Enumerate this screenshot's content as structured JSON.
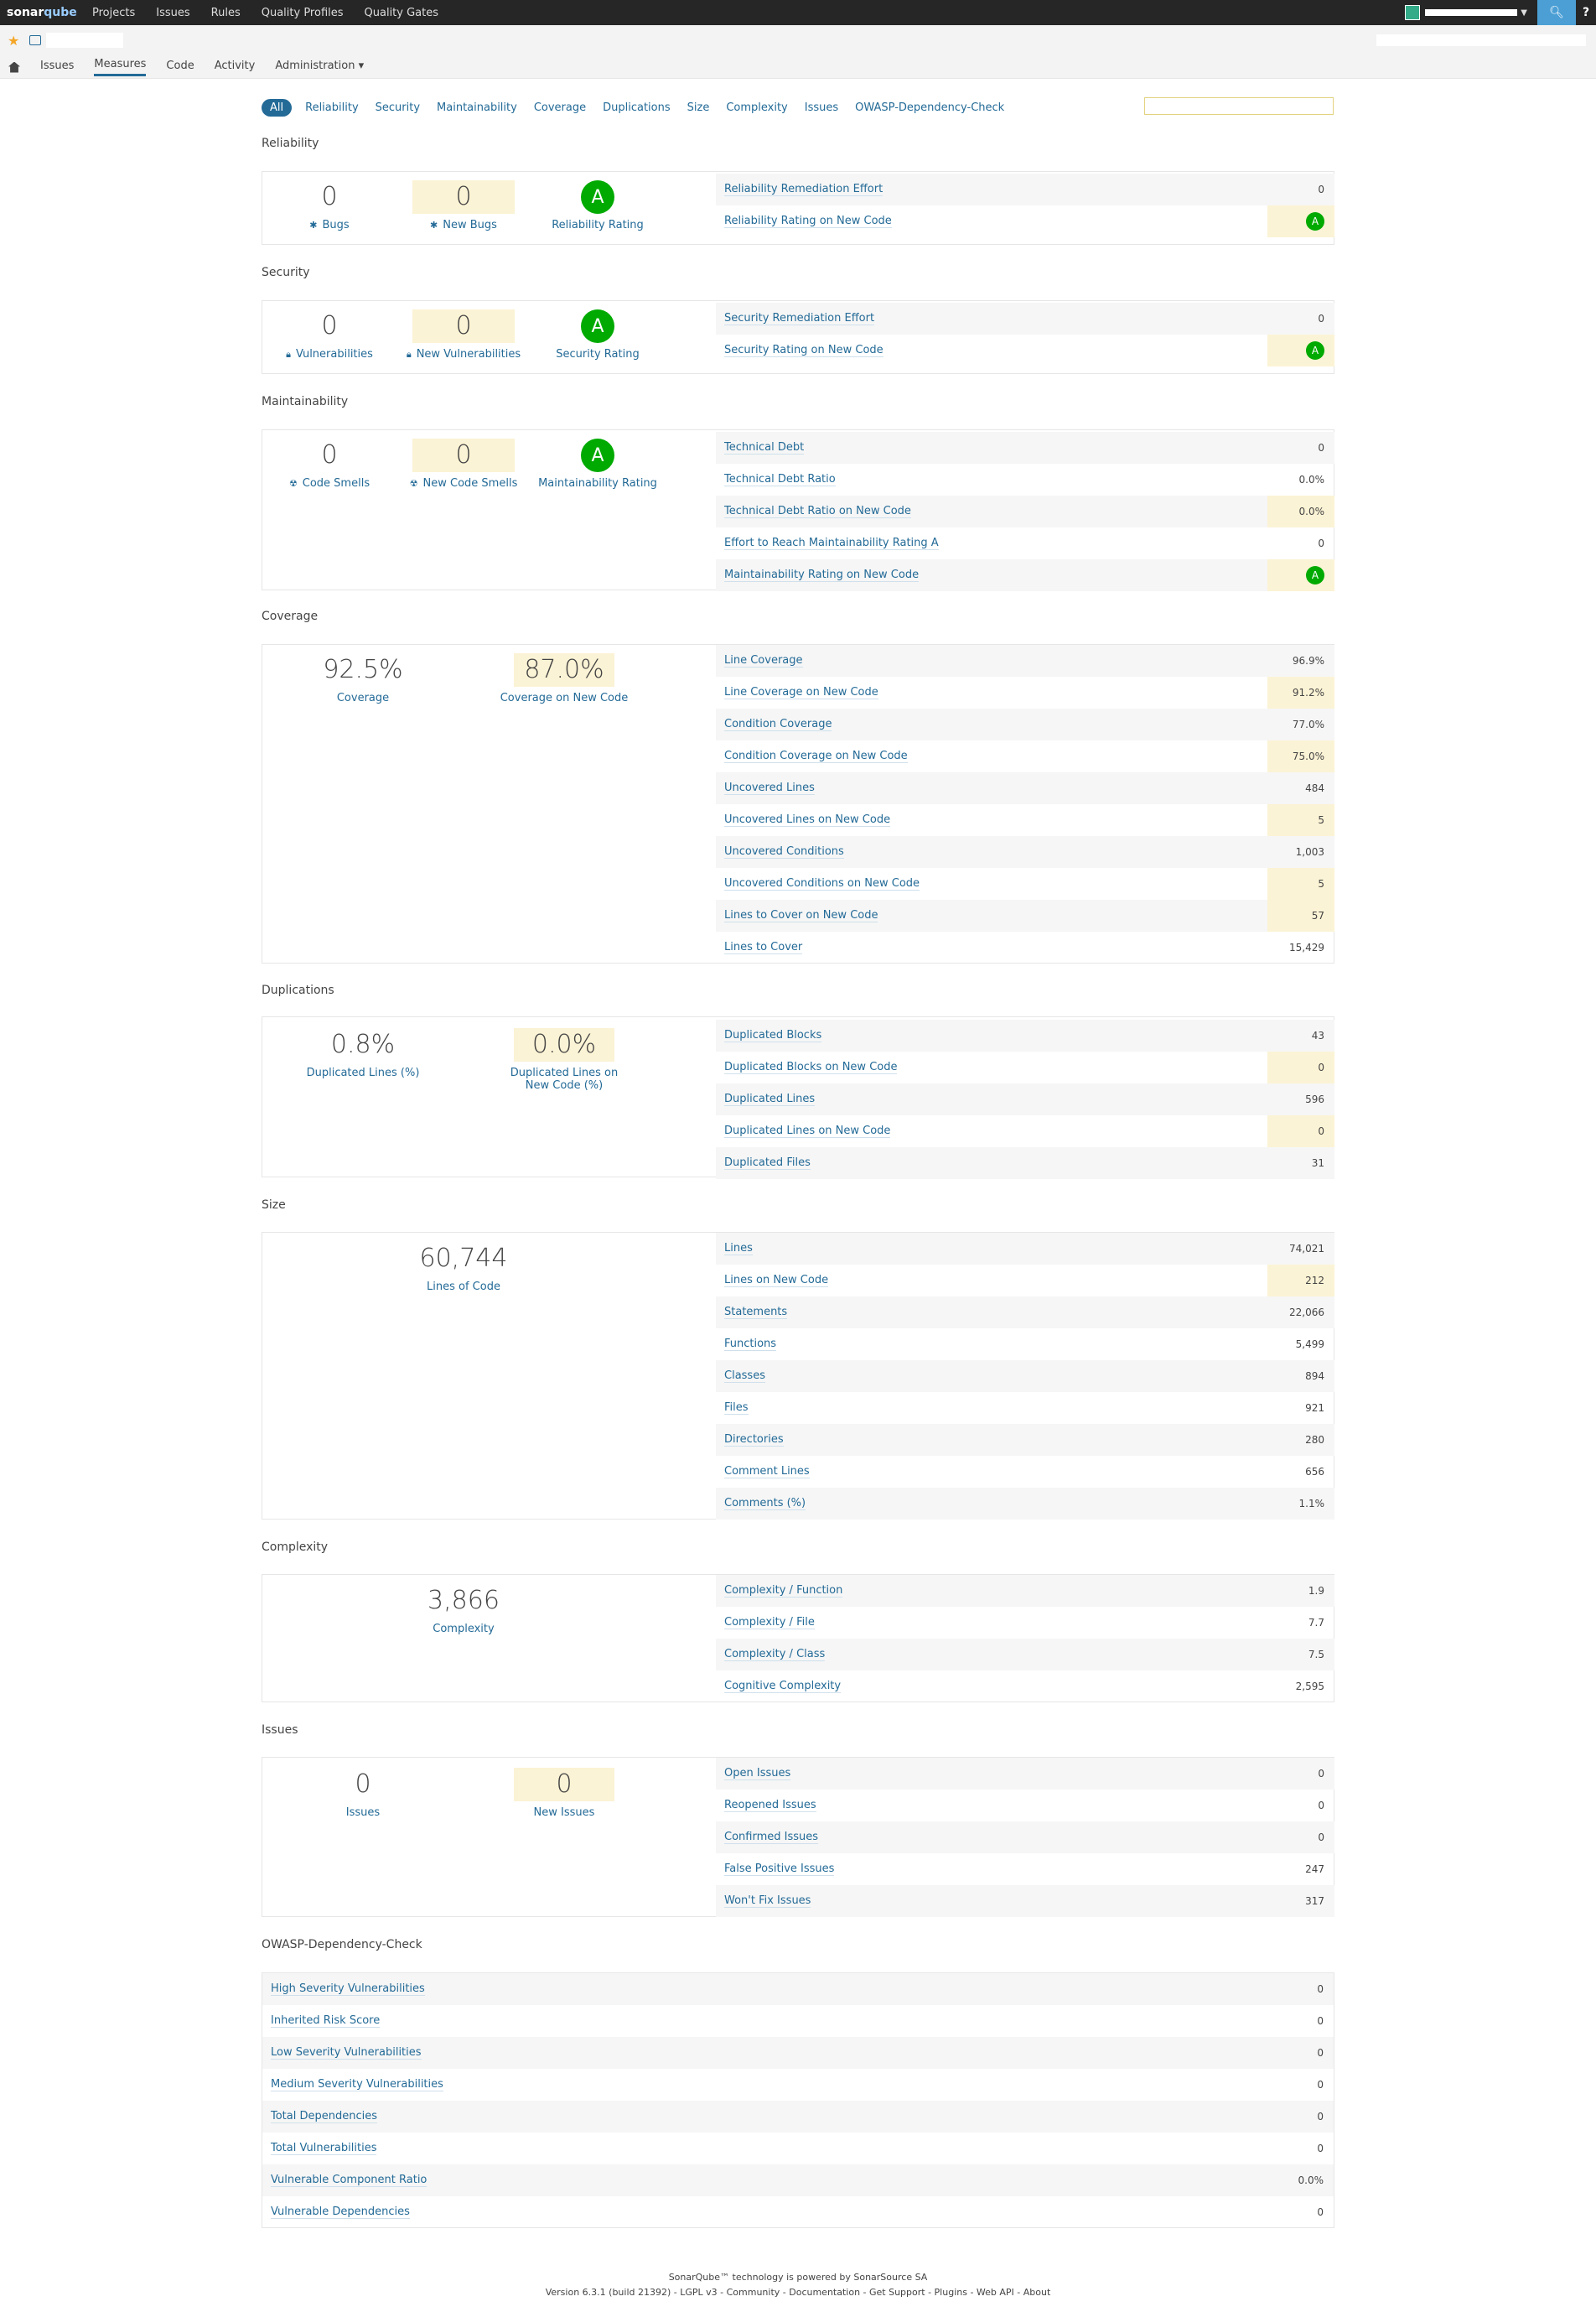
{
  "topbar": {
    "logo_a": "sonar",
    "logo_b": "qube",
    "nav": [
      "Projects",
      "Issues",
      "Rules",
      "Quality Profiles",
      "Quality Gates"
    ]
  },
  "project_tabs": [
    "Issues",
    "Measures",
    "Code",
    "Activity",
    "Administration ▾"
  ],
  "filters": [
    "All",
    "Reliability",
    "Security",
    "Maintainability",
    "Coverage",
    "Duplications",
    "Size",
    "Complexity",
    "Issues",
    "OWASP-Dependency-Check"
  ],
  "sections": {
    "reliability": {
      "title": "Reliability",
      "bugs": {
        "value": "0",
        "label": "Bugs"
      },
      "new_bugs": {
        "value": "0",
        "label": "New Bugs"
      },
      "rating": {
        "value": "A",
        "label": "Reliability Rating"
      },
      "rows": [
        {
          "label": "Reliability Remediation Effort",
          "value": "0"
        },
        {
          "label": "Reliability Rating on New Code",
          "value": "A"
        }
      ]
    },
    "security": {
      "title": "Security",
      "vulns": {
        "value": "0",
        "label": "Vulnerabilities"
      },
      "new_vulns": {
        "value": "0",
        "label": "New Vulnerabilities"
      },
      "rating": {
        "value": "A",
        "label": "Security Rating"
      },
      "rows": [
        {
          "label": "Security Remediation Effort",
          "value": "0"
        },
        {
          "label": "Security Rating on New Code",
          "value": "A"
        }
      ]
    },
    "maintainability": {
      "title": "Maintainability",
      "smells": {
        "value": "0",
        "label": "Code Smells"
      },
      "new_smells": {
        "value": "0",
        "label": "New Code Smells"
      },
      "rating": {
        "value": "A",
        "label": "Maintainability Rating"
      },
      "rows": [
        {
          "label": "Technical Debt",
          "value": "0"
        },
        {
          "label": "Technical Debt Ratio",
          "value": "0.0%"
        },
        {
          "label": "Technical Debt Ratio on New Code",
          "value": "0.0%"
        },
        {
          "label": "Effort to Reach Maintainability Rating A",
          "value": "0"
        },
        {
          "label": "Maintainability Rating on New Code",
          "value": "A"
        }
      ]
    },
    "coverage": {
      "title": "Coverage",
      "coverage": {
        "value": "92.5%",
        "label": "Coverage"
      },
      "new_coverage": {
        "value": "87.0%",
        "label": "Coverage on New Code"
      },
      "rows": [
        {
          "label": "Line Coverage",
          "value": "96.9%"
        },
        {
          "label": "Line Coverage on New Code",
          "value": "91.2%"
        },
        {
          "label": "Condition Coverage",
          "value": "77.0%"
        },
        {
          "label": "Condition Coverage on New Code",
          "value": "75.0%"
        },
        {
          "label": "Uncovered Lines",
          "value": "484"
        },
        {
          "label": "Uncovered Lines on New Code",
          "value": "5"
        },
        {
          "label": "Uncovered Conditions",
          "value": "1,003"
        },
        {
          "label": "Uncovered Conditions on New Code",
          "value": "5"
        },
        {
          "label": "Lines to Cover on New Code",
          "value": "57"
        },
        {
          "label": "Lines to Cover",
          "value": "15,429"
        }
      ]
    },
    "duplications": {
      "title": "Duplications",
      "dup": {
        "value": "0.8%",
        "label": "Duplicated Lines (%)"
      },
      "new_dup": {
        "value": "0.0%",
        "label": "Duplicated Lines on New Code (%)"
      },
      "rows": [
        {
          "label": "Duplicated Blocks",
          "value": "43"
        },
        {
          "label": "Duplicated Blocks on New Code",
          "value": "0"
        },
        {
          "label": "Duplicated Lines",
          "value": "596"
        },
        {
          "label": "Duplicated Lines on New Code",
          "value": "0"
        },
        {
          "label": "Duplicated Files",
          "value": "31"
        }
      ]
    },
    "size": {
      "title": "Size",
      "loc": {
        "value": "60,744",
        "label": "Lines of Code"
      },
      "rows": [
        {
          "label": "Lines",
          "value": "74,021"
        },
        {
          "label": "Lines on New Code",
          "value": "212"
        },
        {
          "label": "Statements",
          "value": "22,066"
        },
        {
          "label": "Functions",
          "value": "5,499"
        },
        {
          "label": "Classes",
          "value": "894"
        },
        {
          "label": "Files",
          "value": "921"
        },
        {
          "label": "Directories",
          "value": "280"
        },
        {
          "label": "Comment Lines",
          "value": "656"
        },
        {
          "label": "Comments (%)",
          "value": "1.1%"
        }
      ]
    },
    "complexity": {
      "title": "Complexity",
      "complexity": {
        "value": "3,866",
        "label": "Complexity"
      },
      "rows": [
        {
          "label": "Complexity / Function",
          "value": "1.9"
        },
        {
          "label": "Complexity / File",
          "value": "7.7"
        },
        {
          "label": "Complexity / Class",
          "value": "7.5"
        },
        {
          "label": "Cognitive Complexity",
          "value": "2,595"
        }
      ]
    },
    "issues": {
      "title": "Issues",
      "issues": {
        "value": "0",
        "label": "Issues"
      },
      "new_issues": {
        "value": "0",
        "label": "New Issues"
      },
      "rows": [
        {
          "label": "Open Issues",
          "value": "0"
        },
        {
          "label": "Reopened Issues",
          "value": "0"
        },
        {
          "label": "Confirmed Issues",
          "value": "0"
        },
        {
          "label": "False Positive Issues",
          "value": "247"
        },
        {
          "label": "Won't Fix Issues",
          "value": "317"
        }
      ]
    },
    "owasp": {
      "title": "OWASP-Dependency-Check",
      "rows": [
        {
          "label": "High Severity Vulnerabilities",
          "value": "0"
        },
        {
          "label": "Inherited Risk Score",
          "value": "0"
        },
        {
          "label": "Low Severity Vulnerabilities",
          "value": "0"
        },
        {
          "label": "Medium Severity Vulnerabilities",
          "value": "0"
        },
        {
          "label": "Total Dependencies",
          "value": "0"
        },
        {
          "label": "Total Vulnerabilities",
          "value": "0"
        },
        {
          "label": "Vulnerable Component Ratio",
          "value": "0.0%"
        },
        {
          "label": "Vulnerable Dependencies",
          "value": "0"
        }
      ]
    }
  },
  "footer": {
    "line1": "SonarQube™ technology is powered by SonarSource SA",
    "line2": "Version 6.3.1 (build 21392) - LGPL v3 - Community - Documentation - Get Support - Plugins - Web API - About"
  },
  "colors": {
    "accent": "#236a97",
    "rating_a": "#00aa00",
    "new_code_bg": "#fbf3d5",
    "topbar": "#262626"
  }
}
